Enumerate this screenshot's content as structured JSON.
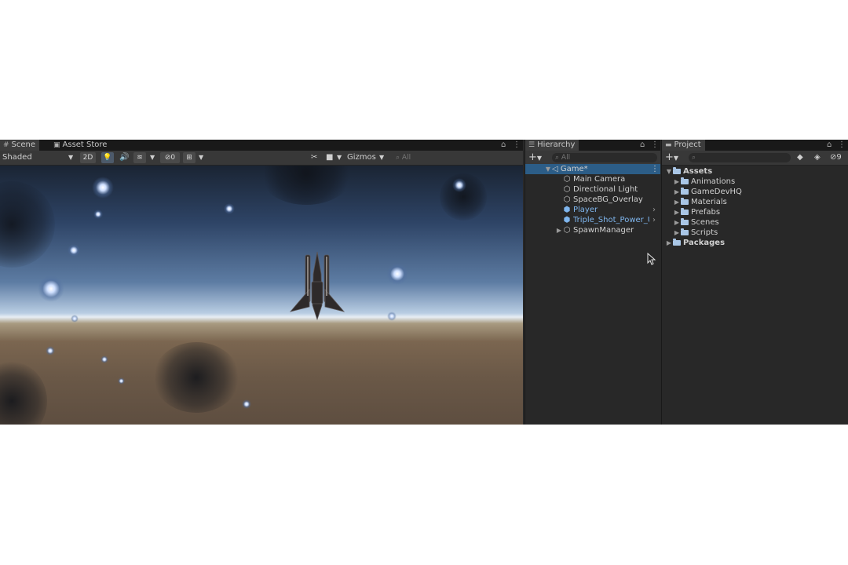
{
  "scene_panel": {
    "tabs": [
      {
        "label": "Scene",
        "icon": "grid-icon"
      },
      {
        "label": "Asset Store",
        "icon": "store-bag-icon"
      }
    ],
    "draw_mode": "Shaded",
    "mode_2d": "2D",
    "hidden_count": "0",
    "gizmos_label": "Gizmos",
    "search_placeholder": "All"
  },
  "hierarchy": {
    "title": "Hierarchy",
    "search_placeholder": "All",
    "add_label": "+",
    "scene_name": "Game*",
    "items": [
      {
        "label": "Main Camera",
        "icon": "gameobject-cube-icon",
        "prefab": false,
        "has_children": false,
        "expandable": false
      },
      {
        "label": "Directional Light",
        "icon": "gameobject-cube-icon",
        "prefab": false,
        "has_children": false,
        "expandable": false
      },
      {
        "label": "SpaceBG_Overlay",
        "icon": "gameobject-cube-icon",
        "prefab": false,
        "has_children": false,
        "expandable": false
      },
      {
        "label": "Player",
        "icon": "prefab-cube-icon",
        "prefab": true,
        "has_children": false,
        "expandable": true
      },
      {
        "label": "Triple_Shot_Power_Up",
        "icon": "prefab-cube-icon",
        "prefab": true,
        "has_children": false,
        "expandable": true
      },
      {
        "label": "SpawnManager",
        "icon": "gameobject-cube-icon",
        "prefab": false,
        "has_children": true,
        "expandable": false
      }
    ]
  },
  "project": {
    "title": "Project",
    "add_label": "+",
    "hidden_count": "9",
    "assets_label": "Assets",
    "folders": [
      "Animations",
      "GameDevHQ",
      "Materials",
      "Prefabs",
      "Scenes",
      "Scripts"
    ],
    "packages_label": "Packages"
  },
  "colors": {
    "editor_bg": "#282828",
    "tab_bar": "#191919",
    "selection": "#2c5d87",
    "prefab_blue": "#7fb6ee"
  }
}
